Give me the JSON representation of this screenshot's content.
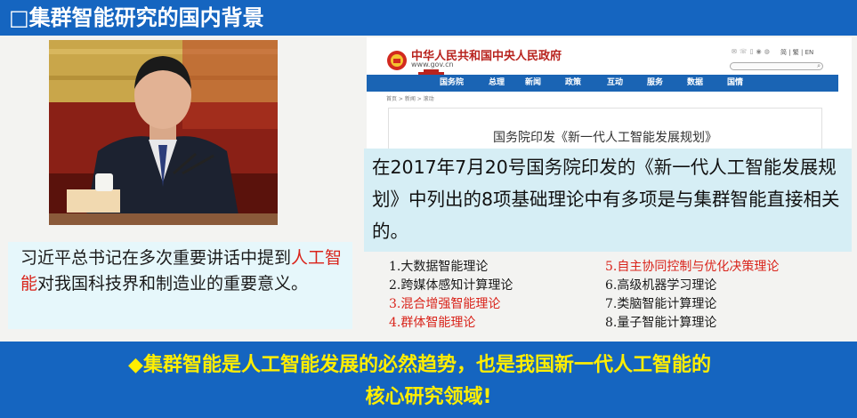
{
  "header": {
    "title": "□集群智能研究的国内背景"
  },
  "quote": {
    "before": "习近平总书记在多次重要讲话中提到",
    "highlight": "人工智能",
    "after": "对我国科技界和制造业的重要意义。"
  },
  "gov_site": {
    "name": "中华人民共和国中央人民政府",
    "url": "www.gov.cn",
    "lang": "简 | 繁 | EN",
    "nav": [
      "国务院",
      "总理",
      "新闻",
      "政策",
      "互动",
      "服务",
      "数据",
      "国情"
    ],
    "breadcrumb": "首页 > 新闻 > 滚动",
    "doc_title": "国务院印发《新一代人工智能发展规划》"
  },
  "overlay": {
    "text": "在2017年7月20号国务院印发的《新一代人工智能发展规划》中列出的8项基础理论中有多项是与集群智能直接相关的。"
  },
  "theories": {
    "left": [
      {
        "text": "1.大数据智能理论",
        "highlight": false
      },
      {
        "text": "2.跨媒体感知计算理论",
        "highlight": false
      },
      {
        "text": "3.混合增强智能理论",
        "highlight": true
      },
      {
        "text": "4.群体智能理论",
        "highlight": true
      }
    ],
    "right": [
      {
        "text": "5.自主协同控制与优化决策理论",
        "highlight": true
      },
      {
        "text": "6.高级机器学习理论",
        "highlight": false
      },
      {
        "text": "7.类脑智能计算理论",
        "highlight": false
      },
      {
        "text": "8.量子智能计算理论",
        "highlight": false
      }
    ]
  },
  "footer": {
    "line1": "◆集群智能是人工智能发展的必然趋势，也是我国新一代人工智能的",
    "line2": "核心研究领域!"
  },
  "colors": {
    "header_blue": "#1565c0",
    "highlight_red": "#d9241b",
    "footer_text_yellow": "#ffee00",
    "overlay_bg": "#d6eef5"
  }
}
